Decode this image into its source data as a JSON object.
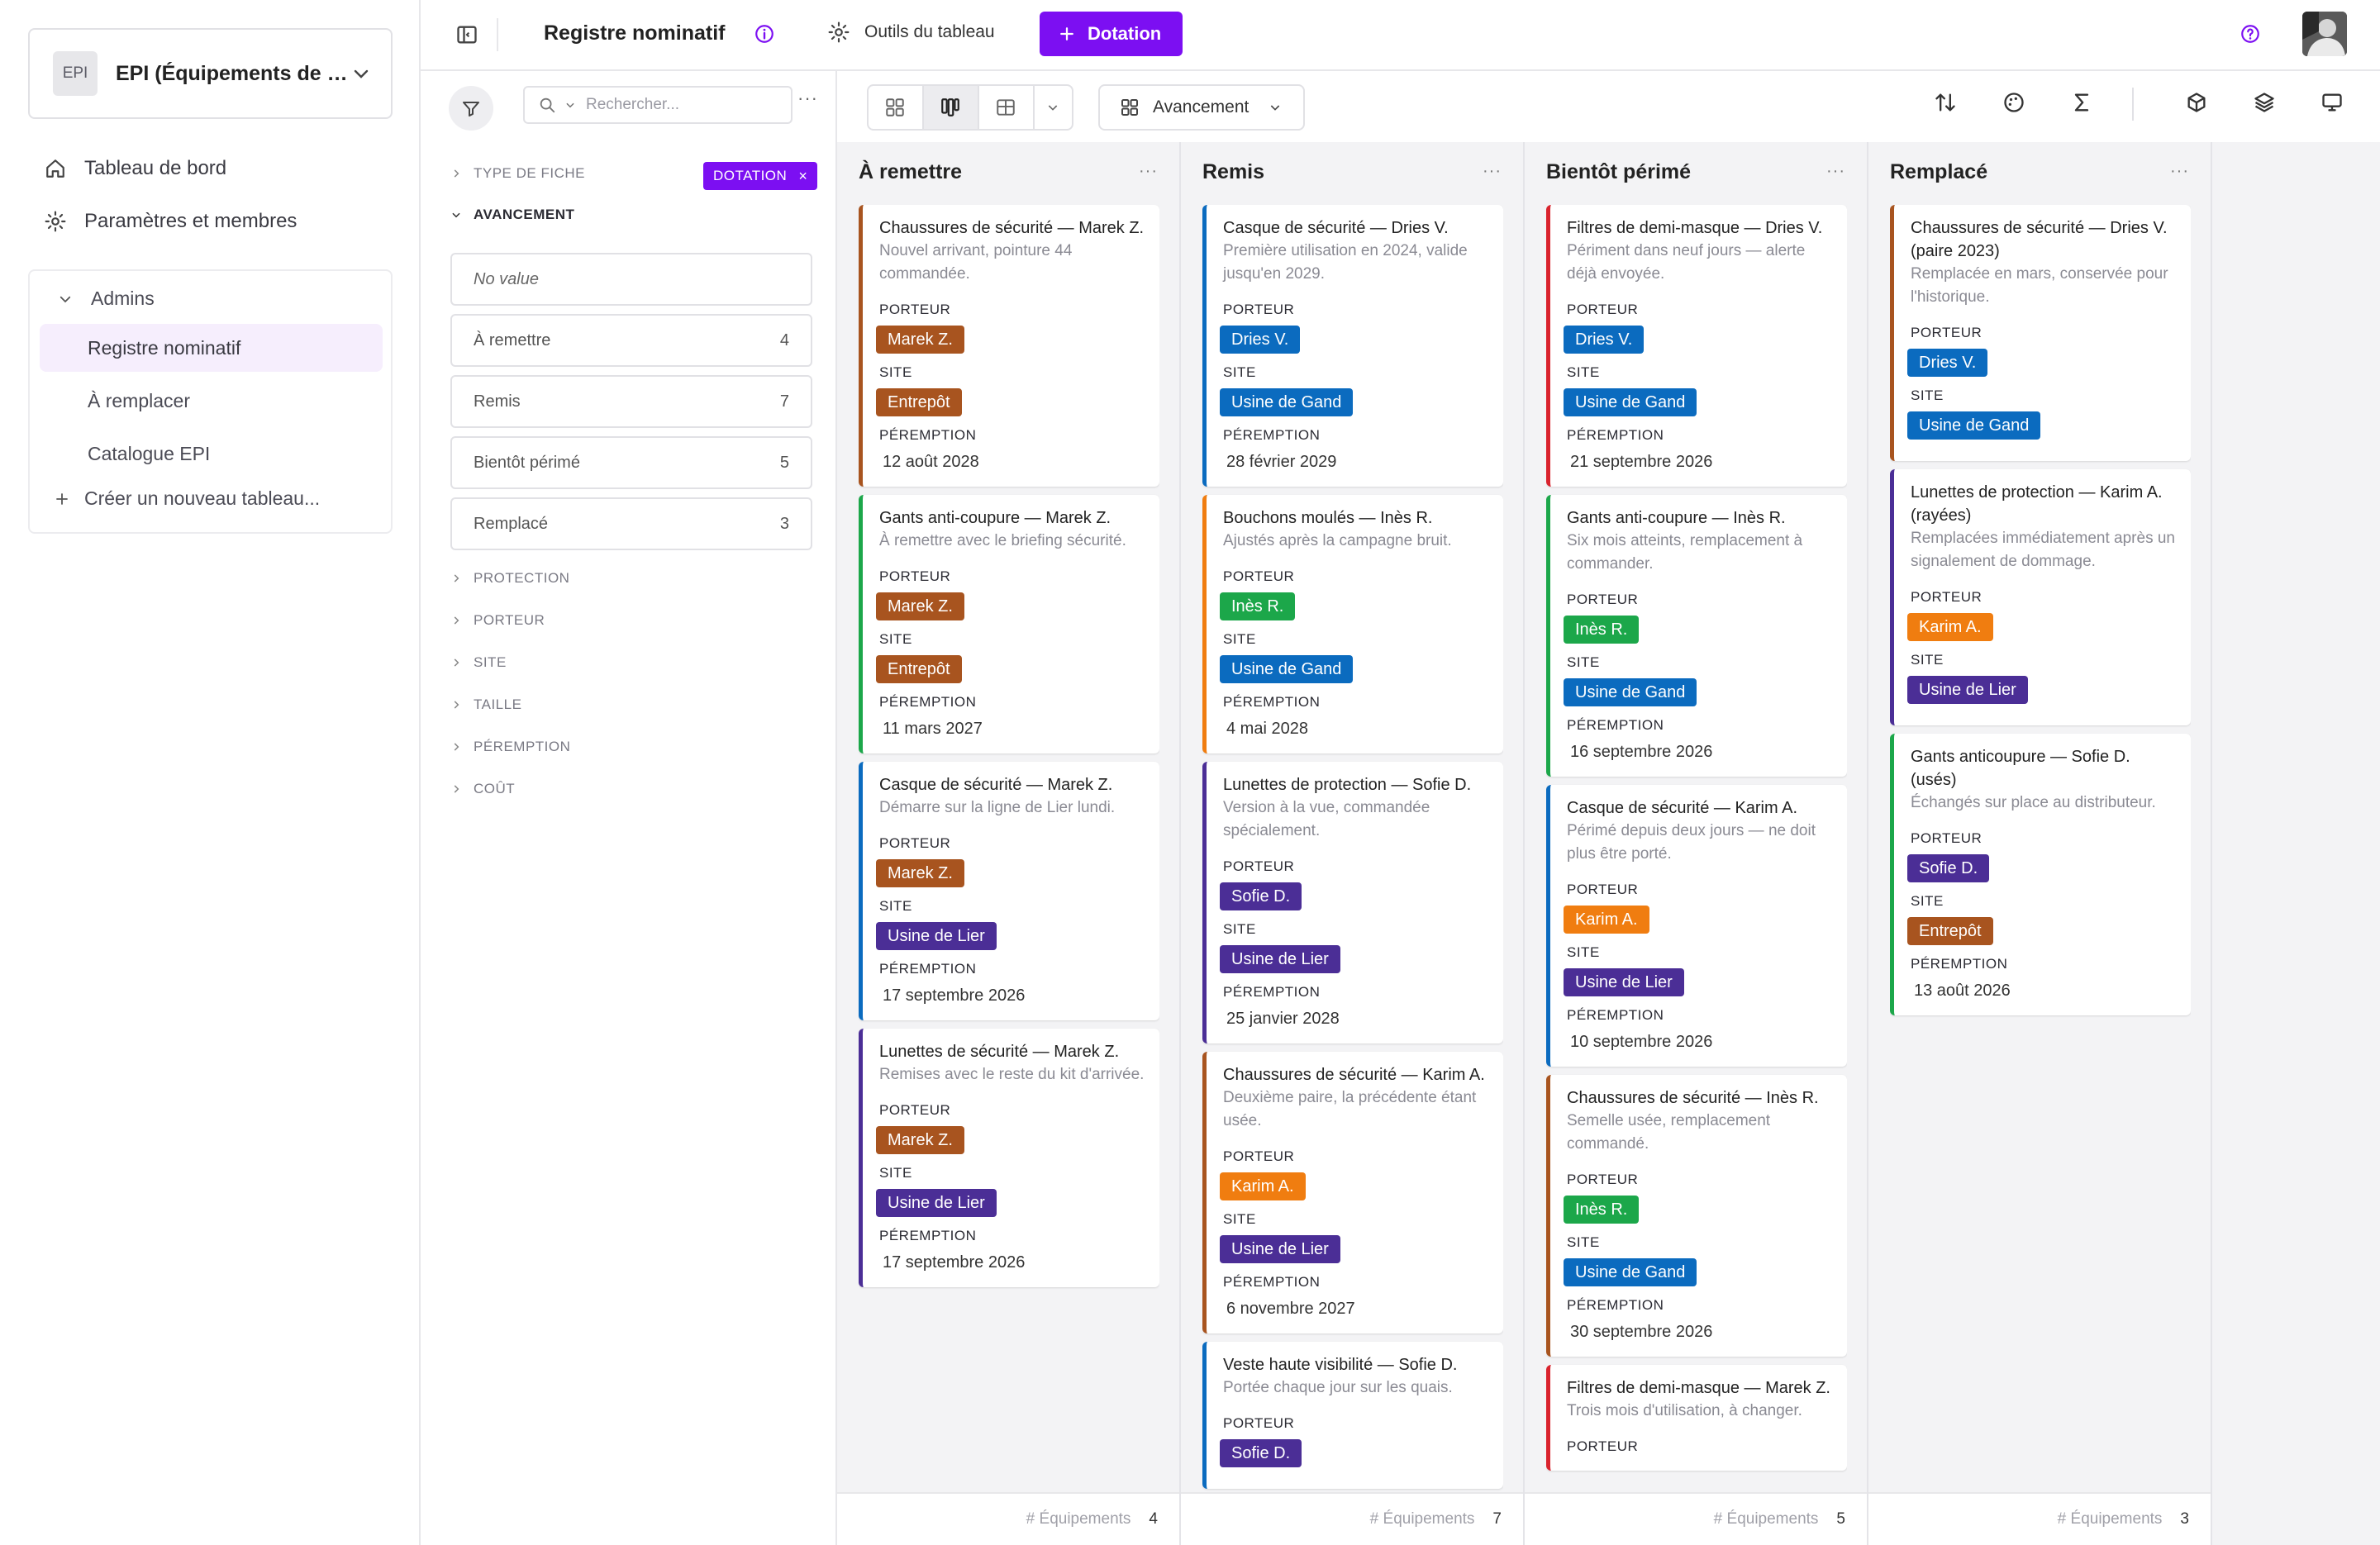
{
  "workspace": {
    "logo": "EPI",
    "name": "EPI (Équipements de protection individuelle)"
  },
  "nav": [
    {
      "label": "Tableau de bord",
      "icon": "home-icon"
    },
    {
      "label": "Paramètres et membres",
      "icon": "gear-icon"
    }
  ],
  "admins": {
    "label": "Admins",
    "tables": [
      "Registre nominatif",
      "À remplacer",
      "Catalogue EPI"
    ],
    "active_table": "Registre nominatif",
    "new_table": "Créer un nouveau tableau..."
  },
  "topbar": {
    "title": "Registre nominatif",
    "tools_label": "Outils du tableau",
    "action_label": "Dotation",
    "accent": "#7c0ff2"
  },
  "filters": {
    "search_placeholder": "Rechercher...",
    "type_label": "TYPE DE FICHE",
    "type_value": "DOTATION",
    "avancement_label": "AVANCEMENT",
    "options": [
      {
        "label": "No value",
        "count": ""
      },
      {
        "label": "À remettre",
        "count": "4"
      },
      {
        "label": "Remis",
        "count": "7"
      },
      {
        "label": "Bientôt périmé",
        "count": "5"
      },
      {
        "label": "Remplacé",
        "count": "3"
      }
    ],
    "sections": [
      "PROTECTION",
      "PORTEUR",
      "SITE",
      "TAILLE",
      "PÉREMPTION",
      "COÛT"
    ]
  },
  "toolbar": {
    "group_by": "Avancement"
  },
  "labels": {
    "porteur": "PORTEUR",
    "site": "SITE",
    "peremption": "PÉREMPTION",
    "footer": "# Équipements"
  },
  "colors": {
    "Marek Z.": "#a8541f",
    "Dries V.": "#0b6bbf",
    "Inès R.": "#1ca74a",
    "Sofie D.": "#4b2e96",
    "Karim A.": "#f07d10",
    "Entrepôt": "#a8541f",
    "Usine de Gand": "#0b6bbf",
    "Usine de Lier": "#4b2e96"
  },
  "columns": [
    {
      "title": "À remettre",
      "count": "4",
      "cards": [
        {
          "title": "Chaussures de sécurité — Marek Z.",
          "desc": "Nouvel arrivant, pointure 44 commandée.",
          "porteur": "Marek Z.",
          "site": "Entrepôt",
          "date": "12 août 2028",
          "accent": "#a8541f"
        },
        {
          "title": "Gants anti-coupure — Marek Z.",
          "desc": "À remettre avec le briefing sécurité.",
          "porteur": "Marek Z.",
          "site": "Entrepôt",
          "date": "11 mars 2027",
          "accent": "#1ca74a"
        },
        {
          "title": "Casque de sécurité — Marek Z.",
          "desc": "Démarre sur la ligne de Lier lundi.",
          "porteur": "Marek Z.",
          "site": "Usine de Lier",
          "date": "17 septembre 2026",
          "accent": "#0b6bbf"
        },
        {
          "title": "Lunettes de sécurité — Marek Z.",
          "desc": "Remises avec le reste du kit d'arrivée.",
          "porteur": "Marek Z.",
          "site": "Usine de Lier",
          "date": "17 septembre 2026",
          "accent": "#4b2e96"
        }
      ]
    },
    {
      "title": "Remis",
      "count": "7",
      "cards": [
        {
          "title": "Casque de sécurité — Dries V.",
          "desc": "Première utilisation en 2024, valide jusqu'en 2029.",
          "porteur": "Dries V.",
          "site": "Usine de Gand",
          "date": "28 février 2029",
          "accent": "#0b6bbf"
        },
        {
          "title": "Bouchons moulés — Inès R.",
          "desc": "Ajustés après la campagne bruit.",
          "porteur": "Inès R.",
          "site": "Usine de Gand",
          "date": "4 mai 2028",
          "accent": "#f07d10"
        },
        {
          "title": "Lunettes de protection — Sofie D.",
          "desc": "Version à la vue, commandée spécialement.",
          "porteur": "Sofie D.",
          "site": "Usine de Lier",
          "date": "25 janvier 2028",
          "accent": "#4b2e96"
        },
        {
          "title": "Chaussures de sécurité — Karim A.",
          "desc": "Deuxième paire, la précédente étant usée.",
          "porteur": "Karim A.",
          "site": "Usine de Lier",
          "date": "6 novembre 2027",
          "accent": "#a8541f"
        },
        {
          "title": "Veste haute visibilité — Sofie D.",
          "desc": "Portée chaque jour sur les quais.",
          "porteur": "Sofie D.",
          "site": "",
          "date": "",
          "accent": "#0b6bbf"
        }
      ]
    },
    {
      "title": "Bientôt périmé",
      "count": "5",
      "cards": [
        {
          "title": "Filtres de demi-masque — Dries V.",
          "desc": "Périment dans neuf jours — alerte déjà envoyée.",
          "porteur": "Dries V.",
          "site": "Usine de Gand",
          "date": "21 septembre 2026",
          "accent": "#d9232d"
        },
        {
          "title": "Gants anti-coupure — Inès R.",
          "desc": "Six mois atteints, remplacement à commander.",
          "porteur": "Inès R.",
          "site": "Usine de Gand",
          "date": "16 septembre 2026",
          "accent": "#1ca74a"
        },
        {
          "title": "Casque de sécurité — Karim A.",
          "desc": "Périmé depuis deux jours — ne doit plus être porté.",
          "porteur": "Karim A.",
          "site": "Usine de Lier",
          "date": "10 septembre 2026",
          "accent": "#0b6bbf"
        },
        {
          "title": "Chaussures de sécurité — Inès R.",
          "desc": "Semelle usée, remplacement commandé.",
          "porteur": "Inès R.",
          "site": "Usine de Gand",
          "date": "30 septembre 2026",
          "accent": "#a8541f"
        },
        {
          "title": "Filtres de demi-masque — Marek Z.",
          "desc": "Trois mois d'utilisation, à changer.",
          "porteur": "",
          "site": "",
          "date": "",
          "accent": "#d9232d"
        }
      ]
    },
    {
      "title": "Remplacé",
      "count": "3",
      "cards": [
        {
          "title": "Chaussures de sécurité — Dries V. (paire 2023)",
          "desc": "Remplacée en mars, conservée pour l'historique.",
          "porteur": "Dries V.",
          "site": "Usine de Gand",
          "date": "",
          "accent": "#a8541f"
        },
        {
          "title": "Lunettes de protection — Karim A. (rayées)",
          "desc": "Remplacées immédiatement après un signalement de dommage.",
          "porteur": "Karim A.",
          "site": "Usine de Lier",
          "date": "",
          "accent": "#4b2e96"
        },
        {
          "title": "Gants anticoupure — Sofie D. (usés)",
          "desc": "Échangés sur place au distributeur.",
          "porteur": "Sofie D.",
          "site": "Entrepôt",
          "date": "13 août 2026",
          "accent": "#1ca74a"
        }
      ]
    }
  ]
}
